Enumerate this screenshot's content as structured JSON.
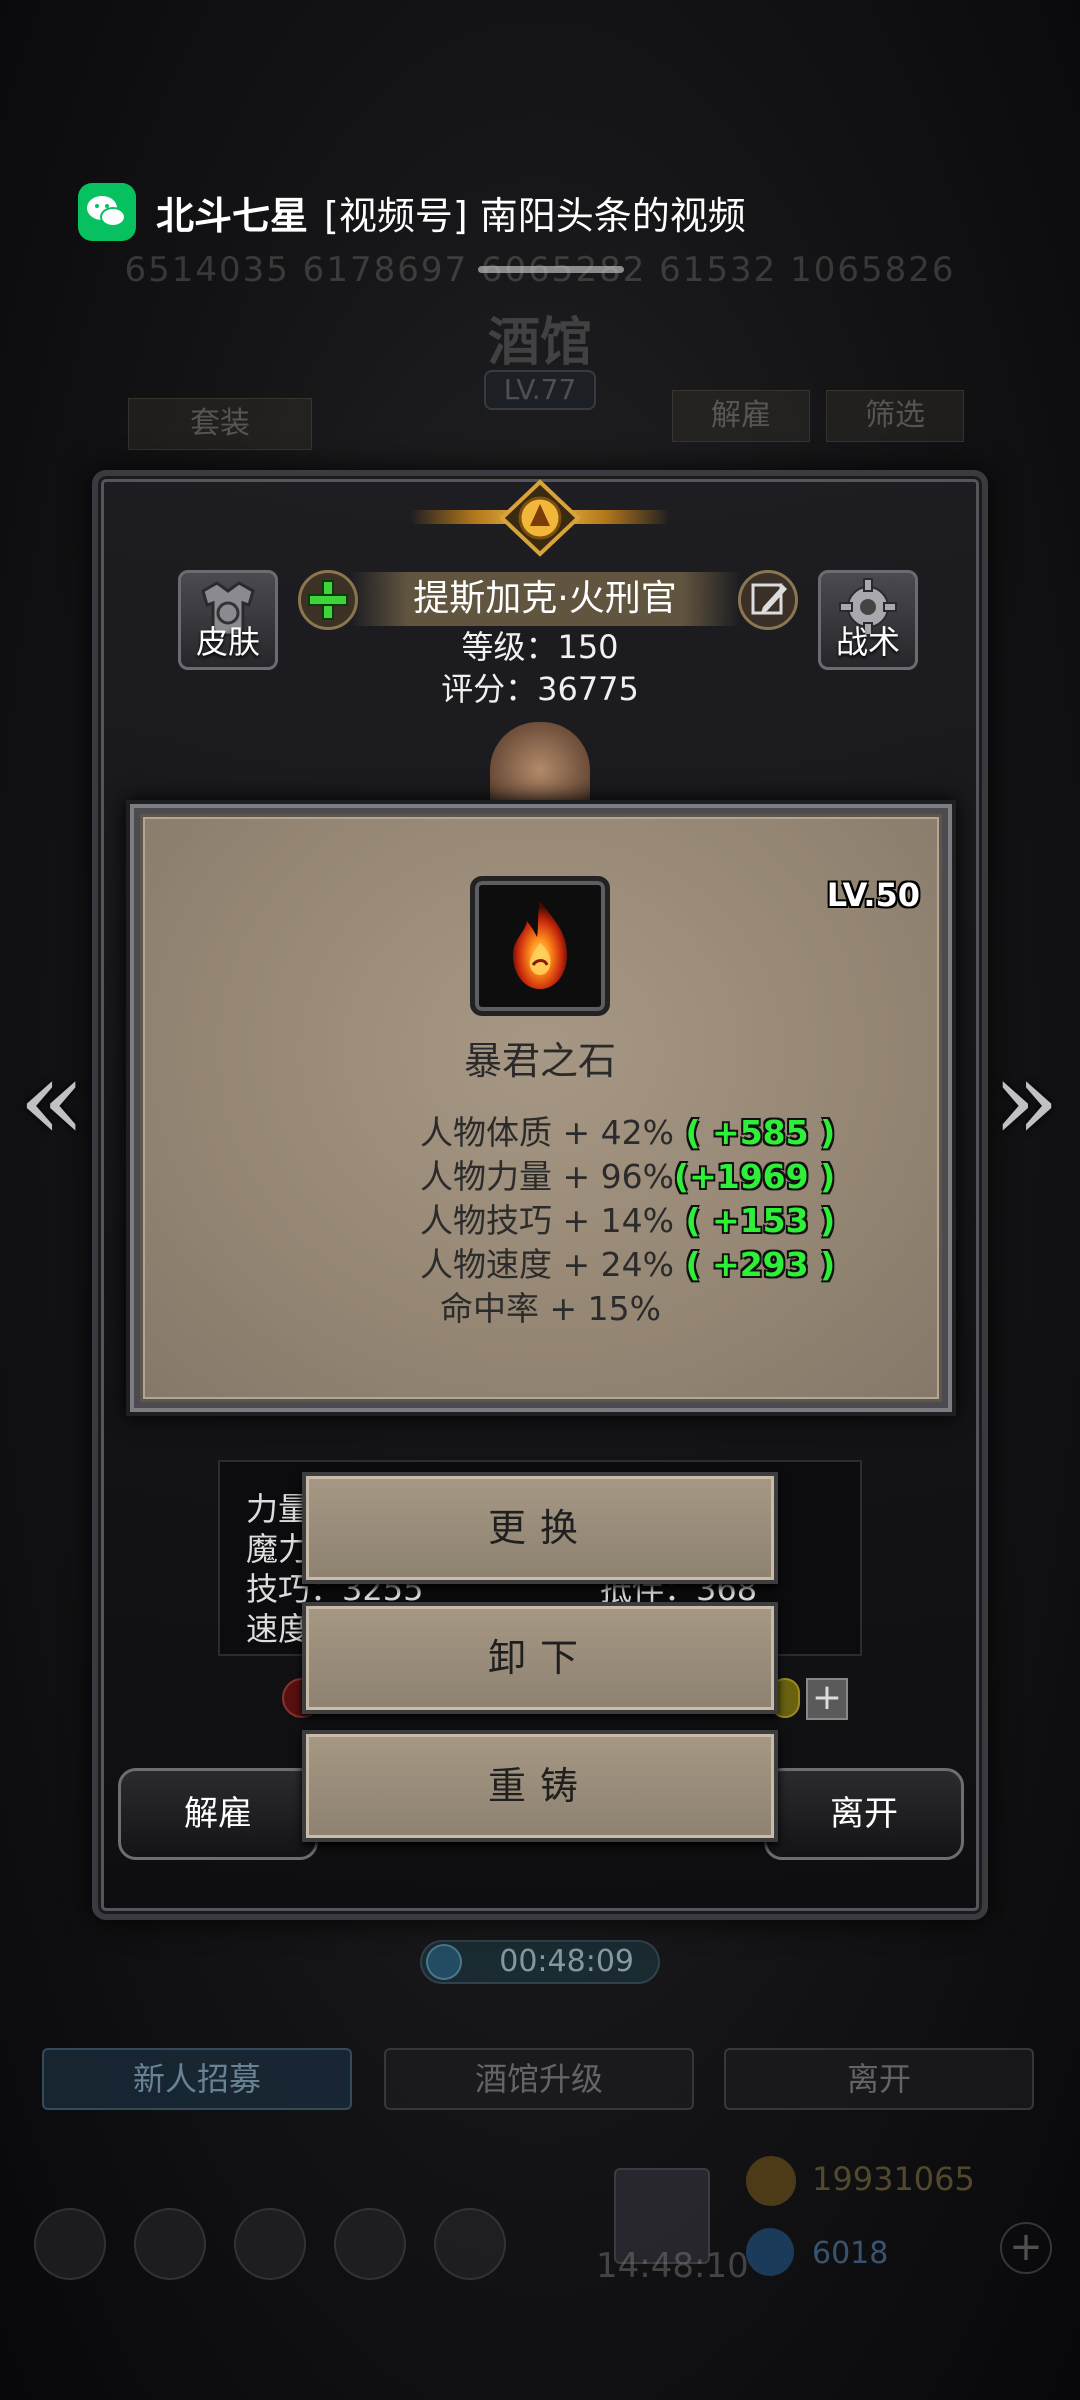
{
  "notification": {
    "app_icon": "wechat-icon",
    "title": "北斗七星",
    "body": "[视频号] 南阳头条的视频"
  },
  "background": {
    "number_strip": "6514035  6178697  6065282  61532  1065826",
    "tavern_title": "酒馆",
    "tavern_level": "LV.77",
    "set_tab": "套装",
    "dismiss_tab": "解雇",
    "filter_tab": "筛选",
    "timer": "00:48:09",
    "bottom_buttons": [
      "新人招募",
      "酒馆升级",
      "离开"
    ],
    "gold": "19931065",
    "gems": "6018",
    "clock": "14:48:10"
  },
  "hero": {
    "skin_label": "皮肤",
    "tactics_label": "战术",
    "name": "提斯加克·火刑官",
    "level_line": "等级：150",
    "score_line": "评分：36775"
  },
  "hero_stats": {
    "row1": "力量",
    "row2": "魔力",
    "row3": "技巧：3255",
    "row3b": "抵伴：368",
    "row4": "速度"
  },
  "item": {
    "level": "LV.50",
    "name": "暴君之石",
    "icon": "flame-stone-icon",
    "attributes": [
      {
        "text": "人物体质 + 42%",
        "bonus": "+585"
      },
      {
        "text": "人物力量 + 96%",
        "bonus": "+1969"
      },
      {
        "text": "人物技巧 + 14%",
        "bonus": "+153"
      },
      {
        "text": "人物速度 + 24%",
        "bonus": "+293"
      },
      {
        "text": "命中率 + 15%",
        "bonus": ""
      }
    ]
  },
  "menu": {
    "replace": "更换",
    "unequip": "卸下",
    "reforge": "重铸"
  },
  "panel_buttons": {
    "dismiss": "解雇",
    "leave": "离开"
  },
  "colors": {
    "bonus_green": "#2ef038",
    "card_bg": "#948673",
    "wechat_green": "#07c160"
  }
}
